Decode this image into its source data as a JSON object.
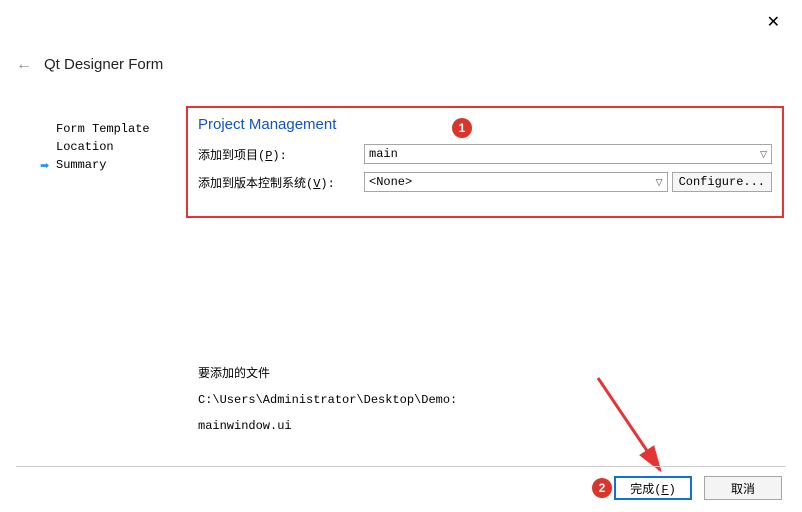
{
  "window": {
    "title": "Qt Designer Form"
  },
  "sidebar": {
    "items": [
      {
        "label": "Form Template"
      },
      {
        "label": "Location"
      },
      {
        "label": "Summary",
        "current": true
      }
    ]
  },
  "section": {
    "title": "Project Management",
    "project_row": {
      "label_prefix": "添加到项目(",
      "label_mnemonic": "P",
      "label_suffix": "):",
      "value": "main"
    },
    "vcs_row": {
      "label_prefix": "添加到版本控制系统(",
      "label_mnemonic": "V",
      "label_suffix": "):",
      "value": "<None>",
      "configure_label": "Configure..."
    }
  },
  "files": {
    "heading": "要添加的文件",
    "path": "C:\\Users\\Administrator\\Desktop\\Demo:",
    "file": "mainwindow.ui"
  },
  "footer": {
    "finish_prefix": "完成(",
    "finish_mnemonic": "F",
    "finish_suffix": ")",
    "cancel": "取消"
  },
  "callouts": {
    "one": "1",
    "two": "2"
  }
}
